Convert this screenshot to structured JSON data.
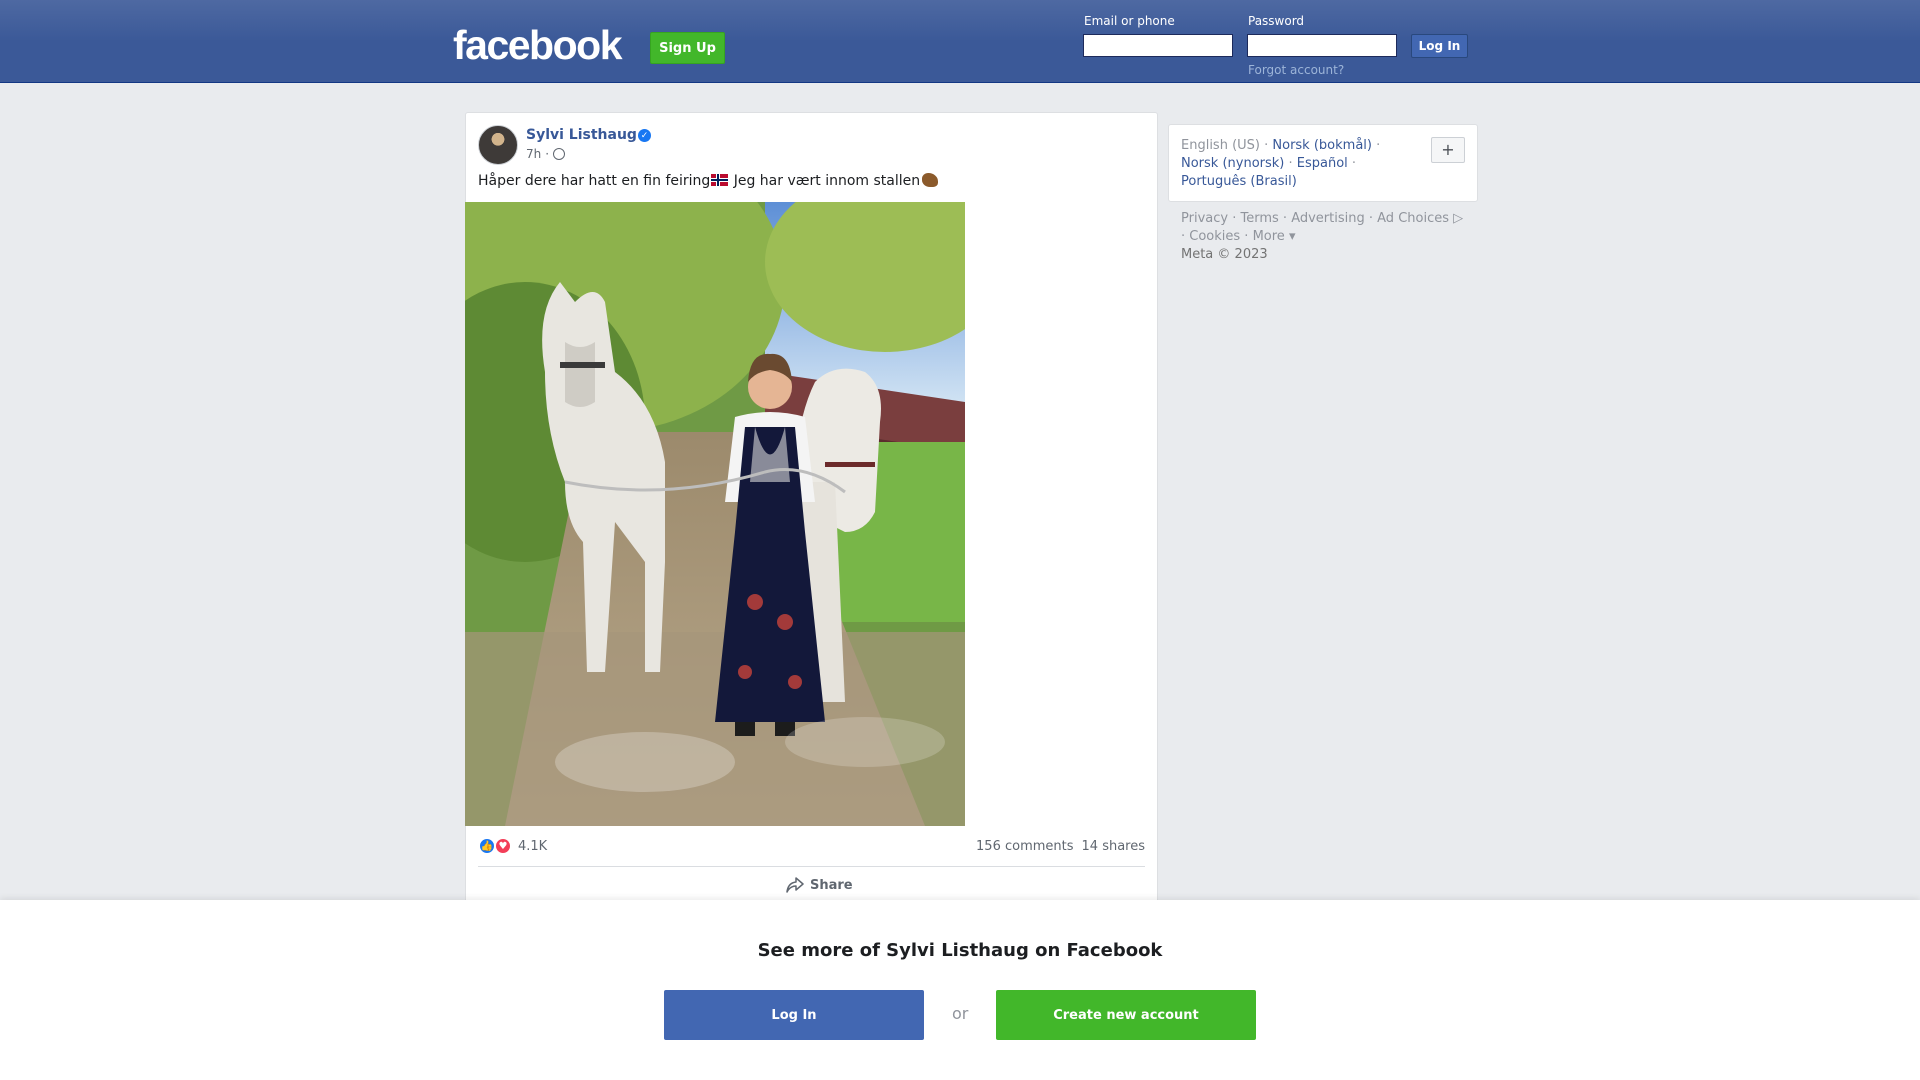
{
  "header": {
    "logo": "facebook",
    "signup_label": "Sign Up",
    "email_label": "Email or phone",
    "password_label": "Password",
    "login_label": "Log In",
    "forgot_label": "Forgot account?"
  },
  "post": {
    "author": "Sylvi Listhaug",
    "time": "7h",
    "audience_icon": "globe-icon",
    "text_part1": "Håper dere har hatt en fin feiring",
    "text_part2": " Jeg har vært innom stallen",
    "emoji_flag": "norway-flag",
    "emoji_horse": "horse-emoji",
    "reaction_count": "4.1K",
    "comments": "156 comments",
    "shares": "14 shares",
    "share_label": "Share"
  },
  "sidebar": {
    "languages": [
      "English (US)",
      "Norsk (bokmål)",
      "Norsk (nynorsk)",
      "Español",
      "Português (Brasil)"
    ],
    "plus_label": "+",
    "footer_links": [
      "Privacy",
      "Terms",
      "Advertising",
      "Ad Choices",
      "Cookies",
      "More"
    ],
    "copyright": "Meta © 2023"
  },
  "bottom": {
    "title": "See more of Sylvi Listhaug on Facebook",
    "login_label": "Log In",
    "or_label": "or",
    "create_label": "Create new account"
  },
  "colors": {
    "header_blue": "#3b5998",
    "signup_green": "#42b72a",
    "link_blue": "#385898",
    "like_blue": "#1877f2",
    "love_red": "#f33e58"
  }
}
